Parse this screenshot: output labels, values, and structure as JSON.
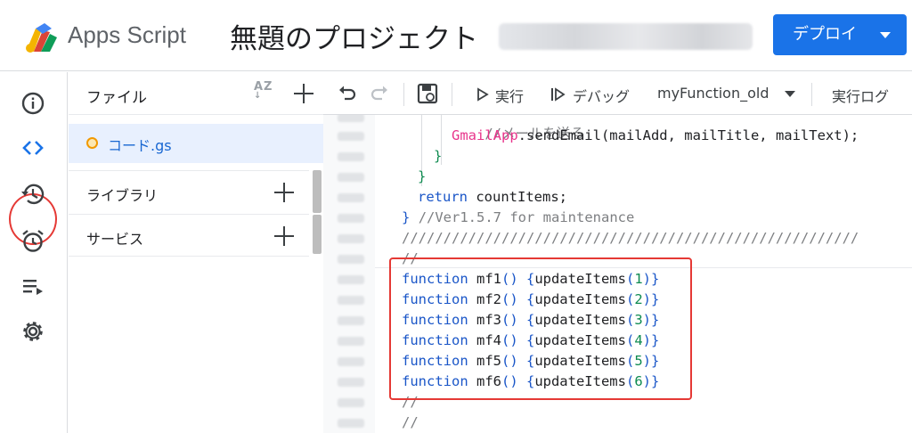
{
  "header": {
    "app_name": "Apps Script",
    "project_title": "無題のプロジェクト",
    "deploy_label": "デプロイ",
    "brand_color": "#1a73e8"
  },
  "rail": {
    "icons": [
      "info-icon",
      "code-icon",
      "history-icon",
      "alarm-icon",
      "playlist-icon",
      "settings-icon"
    ],
    "active": "code-icon"
  },
  "panel": {
    "title": "ファイル",
    "sort_label": "AZ",
    "files": [
      {
        "name": "コード.gs"
      }
    ],
    "sections": [
      {
        "label": "ライブラリ"
      },
      {
        "label": "サービス"
      }
    ]
  },
  "toolbar": {
    "run_label": "実行",
    "debug_label": "デバッグ",
    "function_select": "myFunction_old",
    "log_label": "実行ログ"
  },
  "code": {
    "comment_top": "//メールを送る",
    "gmail_class": "GmailApp",
    "gmail_call": ".sendEmail(mailAdd, mailTitle, mailText);",
    "return_kw": "return",
    "return_val": " countItems;",
    "version_comment": "//Ver1.5.7 for maintenance",
    "slash_line": "///////////////////////////////////////////////////////",
    "comment_empty": "//",
    "functions": [
      {
        "keyword": "function",
        "name": " mf1",
        "call": "updateItems",
        "arg": "1"
      },
      {
        "keyword": "function",
        "name": " mf2",
        "call": "updateItems",
        "arg": "2"
      },
      {
        "keyword": "function",
        "name": " mf3",
        "call": "updateItems",
        "arg": "3"
      },
      {
        "keyword": "function",
        "name": " mf4",
        "call": "updateItems",
        "arg": "4"
      },
      {
        "keyword": "function",
        "name": " mf5",
        "call": "updateItems",
        "arg": "5"
      },
      {
        "keyword": "function",
        "name": " mf6",
        "call": "updateItems",
        "arg": "6"
      }
    ]
  }
}
